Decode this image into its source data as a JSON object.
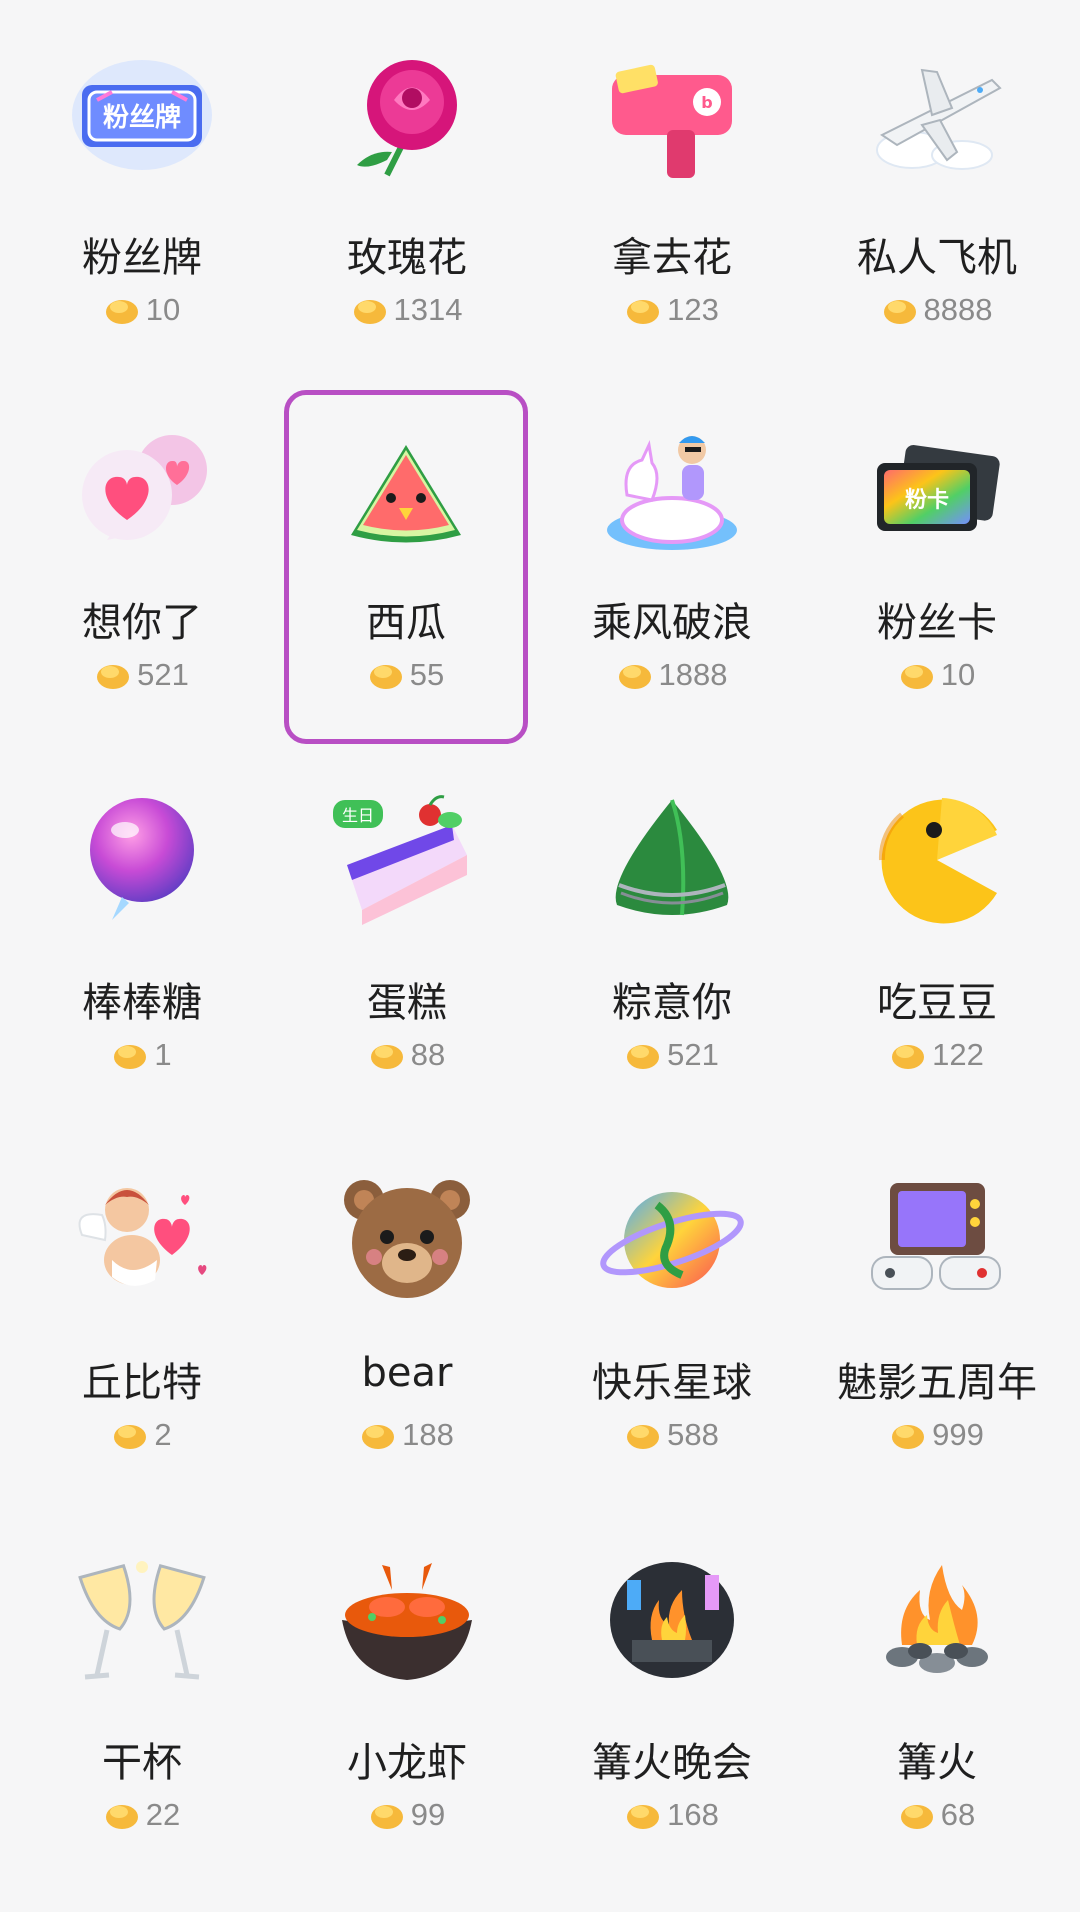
{
  "gifts": [
    {
      "name": "粉丝牌",
      "price": "10",
      "icon": "fan-badge-icon"
    },
    {
      "name": "玫瑰花",
      "price": "1314",
      "icon": "rose-icon"
    },
    {
      "name": "拿去花",
      "price": "123",
      "icon": "money-gun-icon"
    },
    {
      "name": "私人飞机",
      "price": "8888",
      "icon": "private-jet-icon"
    },
    {
      "name": "想你了",
      "price": "521",
      "icon": "heart-bubble-icon"
    },
    {
      "name": "西瓜",
      "price": "55",
      "icon": "watermelon-icon",
      "selected": true
    },
    {
      "name": "乘风破浪",
      "price": "1888",
      "icon": "unicorn-float-icon"
    },
    {
      "name": "粉丝卡",
      "price": "10",
      "icon": "fan-card-icon"
    },
    {
      "name": "棒棒糖",
      "price": "1",
      "icon": "lollipop-icon"
    },
    {
      "name": "蛋糕",
      "price": "88",
      "icon": "cake-icon",
      "badge": "生日"
    },
    {
      "name": "粽意你",
      "price": "521",
      "icon": "zongzi-icon"
    },
    {
      "name": "吃豆豆",
      "price": "122",
      "icon": "pacman-icon"
    },
    {
      "name": "丘比特",
      "price": "2",
      "icon": "cupid-icon"
    },
    {
      "name": "bear",
      "price": "188",
      "icon": "bear-icon"
    },
    {
      "name": "快乐星球",
      "price": "588",
      "icon": "planet-icon"
    },
    {
      "name": "魅影五周年",
      "price": "999",
      "icon": "retro-tv-icon"
    },
    {
      "name": "干杯",
      "price": "22",
      "icon": "cheers-glasses-icon"
    },
    {
      "name": "小龙虾",
      "price": "99",
      "icon": "crayfish-icon"
    },
    {
      "name": "篝火晚会",
      "price": "168",
      "icon": "bonfire-party-icon"
    },
    {
      "name": "篝火",
      "price": "68",
      "icon": "bonfire-icon"
    }
  ],
  "colors": {
    "selected_border": "#b84fc4",
    "coin": "#f6b93b",
    "price_text": "#8a8a8a"
  }
}
